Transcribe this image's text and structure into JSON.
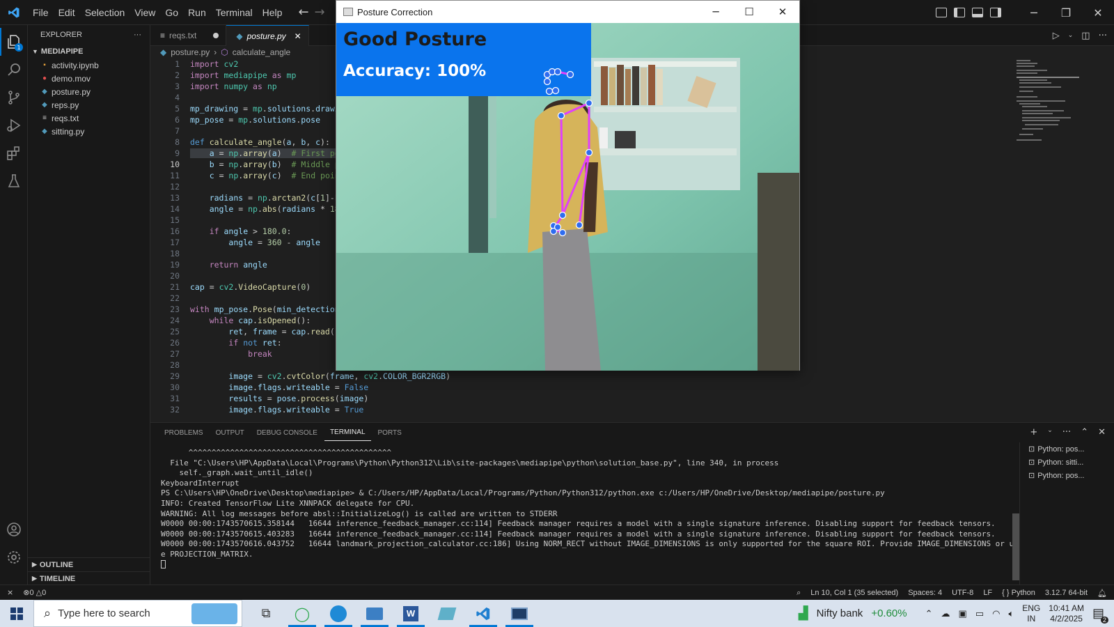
{
  "titlebar": {
    "menu": [
      "File",
      "Edit",
      "Selection",
      "View",
      "Go",
      "Run",
      "Terminal",
      "Help"
    ]
  },
  "activity": {
    "explorer_badge": "1"
  },
  "sidebar": {
    "title": "EXPLORER",
    "folder": "MEDIAPIPE",
    "files": [
      {
        "name": "activity.ipynb",
        "icon": "notebook-icon",
        "color": "#e8a33b"
      },
      {
        "name": "demo.mov",
        "icon": "video-icon",
        "color": "#e24f4f"
      },
      {
        "name": "posture.py",
        "icon": "python-icon",
        "color": "#519aba"
      },
      {
        "name": "reps.py",
        "icon": "python-icon",
        "color": "#519aba"
      },
      {
        "name": "reqs.txt",
        "icon": "text-icon",
        "color": "#cccccc"
      },
      {
        "name": "sitting.py",
        "icon": "python-icon",
        "color": "#519aba"
      }
    ],
    "outline": "OUTLINE",
    "timeline": "TIMELINE"
  },
  "tabs": [
    {
      "label": "reqs.txt",
      "dirty": true
    },
    {
      "label": "posture.py",
      "dirty": false
    }
  ],
  "breadcrumb": {
    "file": "posture.py",
    "symbol": "calculate_angle"
  },
  "editor": {
    "line_numbers": [
      "1",
      "2",
      "3",
      "4",
      "5",
      "6",
      "7",
      "8",
      "9",
      "10",
      "11",
      "12",
      "13",
      "14",
      "15",
      "16",
      "17",
      "18",
      "19",
      "20",
      "21",
      "22",
      "23",
      "24",
      "25",
      "26",
      "27",
      "28",
      "29",
      "30",
      "31",
      "32"
    ],
    "current_line": 10,
    "selected_line": 9
  },
  "posture_window": {
    "title": "Posture Correction",
    "status": "Good Posture",
    "accuracy": "Accuracy: 100%",
    "banner_color": "#0a74ed",
    "landmark_color": "#e040fb"
  },
  "panel": {
    "tabs": [
      "PROBLEMS",
      "OUTPUT",
      "DEBUG CONSOLE",
      "TERMINAL",
      "PORTS"
    ],
    "active_tab": "TERMINAL",
    "terminal_lines": [
      "      ^^^^^^^^^^^^^^^^^^^^^^^^^^^^^^^^^^^^^^^^^^^^",
      "  File \"C:\\Users\\HP\\AppData\\Local\\Programs\\Python\\Python312\\Lib\\site-packages\\mediapipe\\python\\solution_base.py\", line 340, in process",
      "    self._graph.wait_until_idle()",
      "KeyboardInterrupt",
      "PS C:\\Users\\HP\\OneDrive\\Desktop\\mediapipe> & C:/Users/HP/AppData/Local/Programs/Python/Python312/python.exe c:/Users/HP/OneDrive/Desktop/mediapipe/posture.py",
      "INFO: Created TensorFlow Lite XNNPACK delegate for CPU.",
      "WARNING: All log messages before absl::InitializeLog() is called are written to STDERR",
      "W0000 00:00:1743570615.358144   16644 inference_feedback_manager.cc:114] Feedback manager requires a model with a single signature inference. Disabling support for feedback tensors.",
      "W0000 00:00:1743570615.403283   16644 inference_feedback_manager.cc:114] Feedback manager requires a model with a single signature inference. Disabling support for feedback tensors.",
      "W0000 00:00:1743570616.043752   16644 landmark_projection_calculator.cc:186] Using NORM_RECT without IMAGE_DIMENSIONS is only supported for the square ROI. Provide IMAGE_DIMENSIONS or us",
      "e PROJECTION_MATRIX."
    ],
    "terminal_instances": [
      "Python: pos...",
      "Python: sitti...",
      "Python: pos..."
    ]
  },
  "statusbar": {
    "problems": "0",
    "warnings": "0",
    "position": "Ln 10, Col 1 (35 selected)",
    "spaces": "Spaces: 4",
    "encoding": "UTF-8",
    "eol": "LF",
    "language": "Python",
    "interpreter": "3.12.7 64-bit"
  },
  "taskbar": {
    "search_placeholder": "Type here to search",
    "widget_label": "Nifty bank",
    "widget_change": "+0.60%",
    "language_1": "ENG",
    "language_2": "IN",
    "time": "10:41 AM",
    "date": "4/2/2025",
    "notification_count": "2"
  }
}
